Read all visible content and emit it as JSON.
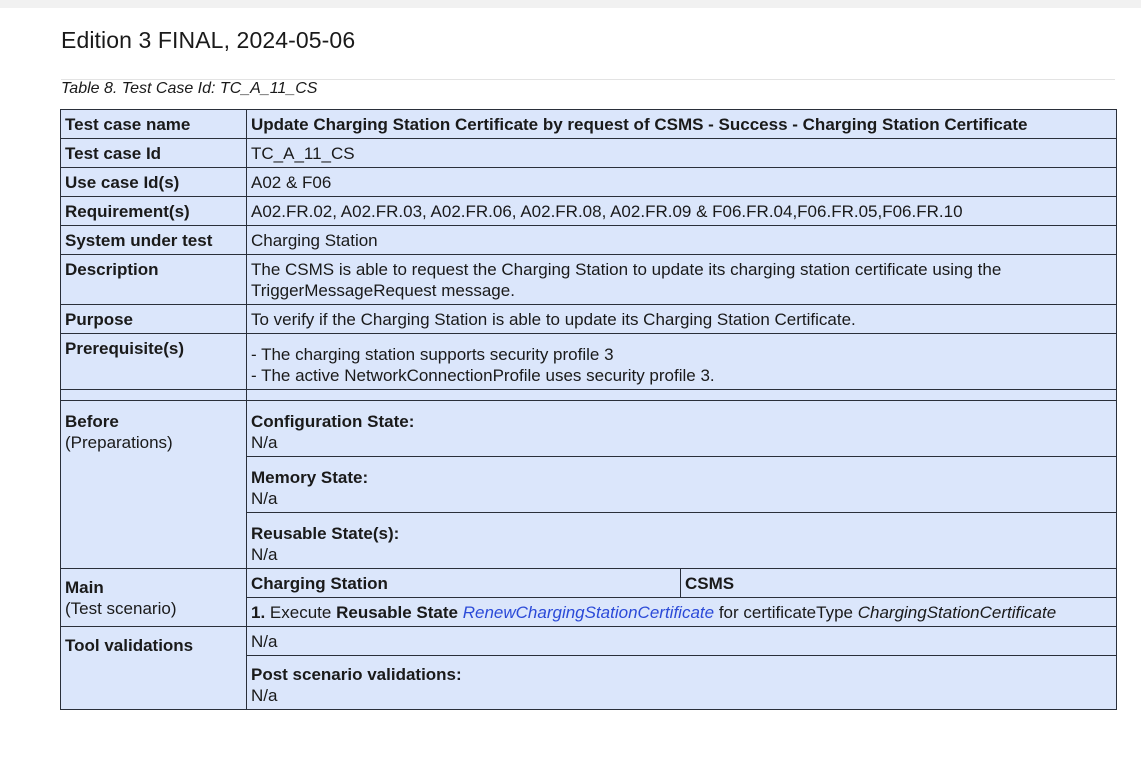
{
  "header": {
    "edition": "Edition 3 FINAL, 2024-05-06"
  },
  "caption": "Table 8. Test Case Id: TC_A_11_CS",
  "table": {
    "test_case_name_label": "Test case name",
    "test_case_name_value": "Update Charging Station Certificate by request of CSMS - Success - Charging Station Certificate",
    "test_case_id_label": "Test case Id",
    "test_case_id_value": "TC_A_11_CS",
    "use_case_label": "Use case Id(s)",
    "use_case_value": "A02 & F06",
    "requirements_label": "Requirement(s)",
    "requirements_value": "A02.FR.02, A02.FR.03, A02.FR.06, A02.FR.08, A02.FR.09 & F06.FR.04,F06.FR.05,F06.FR.10",
    "sut_label": "System under test",
    "sut_value": "Charging Station",
    "description_label": "Description",
    "description_line1": "The CSMS is able to request the Charging Station to update its charging station certificate using the",
    "description_line2": "TriggerMessageRequest message.",
    "purpose_label": "Purpose",
    "purpose_value": "To verify if the Charging Station is able to update its Charging Station Certificate.",
    "prerequisites_label": "Prerequisite(s)",
    "prerequisite_1": "- The charging station supports security profile 3",
    "prerequisite_2": "- The active NetworkConnectionProfile uses security profile 3.",
    "before_label": "Before",
    "before_sub": "(Preparations)",
    "config_state_label": "Configuration State:",
    "config_state_value": "N/a",
    "memory_state_label": "Memory State:",
    "memory_state_value": "N/a",
    "reusable_state_label": "Reusable State(s):",
    "reusable_state_value": "N/a",
    "main_label": "Main",
    "main_sub": "(Test scenario)",
    "col_charging_station": "Charging Station",
    "col_csms": "CSMS",
    "step_number": "1.",
    "step_execute": "Execute",
    "step_reusable_state": "Reusable State",
    "step_link": "RenewChargingStationCertificate",
    "step_for": "for certificateType",
    "step_cert_type": "ChargingStationCertificate",
    "tool_validations_label": "Tool validations",
    "tool_validations_value": "N/a",
    "post_scenario_label": "Post scenario validations:",
    "post_scenario_value": "N/a"
  }
}
